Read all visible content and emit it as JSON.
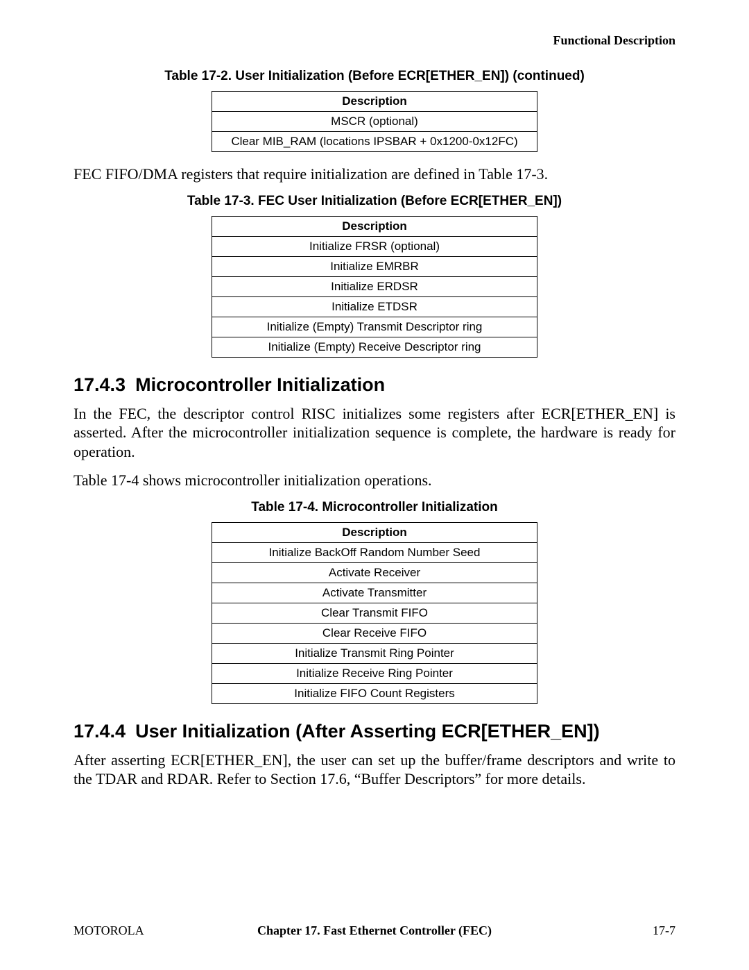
{
  "header": {
    "running_head": "Functional Description"
  },
  "table1": {
    "caption": "Table 17-2. User Initialization (Before ECR[ETHER_EN]) (continued)",
    "header": "Description",
    "rows": [
      "MSCR (optional)",
      "Clear MIB_RAM (locations IPSBAR + 0x1200-0x12FC)"
    ]
  },
  "para1": "FEC FIFO/DMA registers that require initialization are defined in Table 17-3.",
  "table2": {
    "caption": "Table 17-3. FEC User Initialization (Before ECR[ETHER_EN])",
    "header": "Description",
    "rows": [
      "Initialize FRSR (optional)",
      "Initialize EMRBR",
      "Initialize ERDSR",
      "Initialize ETDSR",
      "Initialize (Empty) Transmit Descriptor ring",
      "Initialize (Empty) Receive Descriptor ring"
    ]
  },
  "section1": {
    "number": "17.4.3",
    "title": "Microcontroller Initialization"
  },
  "para2": "In the FEC, the descriptor control RISC initializes some registers after ECR[ETHER_EN] is asserted. After the microcontroller initialization sequence is complete, the hardware is ready for operation.",
  "para3": "Table 17-4 shows microcontroller initialization operations.",
  "table3": {
    "caption": "Table 17-4. Microcontroller Initialization",
    "header": "Description",
    "rows": [
      "Initialize BackOff Random Number Seed",
      "Activate Receiver",
      "Activate Transmitter",
      "Clear Transmit FIFO",
      "Clear Receive FIFO",
      "Initialize Transmit Ring Pointer",
      "Initialize Receive Ring Pointer",
      "Initialize FIFO Count Registers"
    ]
  },
  "section2": {
    "number": "17.4.4",
    "title": "User Initialization (After Asserting ECR[ETHER_EN])"
  },
  "para4": "After asserting ECR[ETHER_EN], the user can set up the buffer/frame descriptors and write to the TDAR and RDAR. Refer to Section 17.6, “Buffer Descriptors” for more details.",
  "footer": {
    "left": "MOTOROLA",
    "center": "Chapter 17.  Fast Ethernet Controller (FEC)",
    "right": "17-7"
  }
}
